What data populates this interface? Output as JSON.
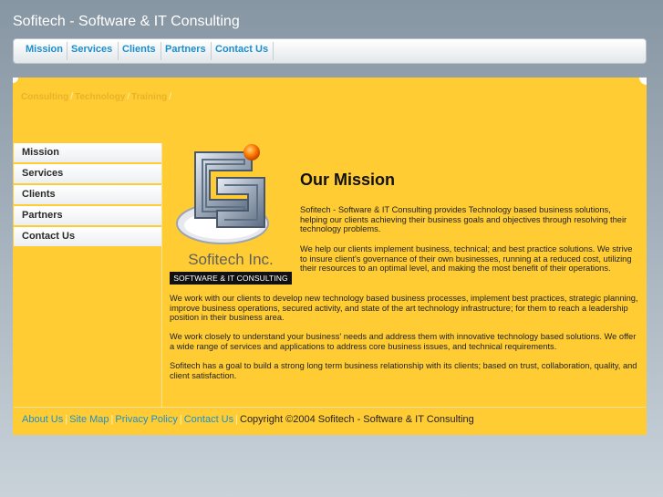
{
  "site": {
    "title": "Sofitech - Software & IT Consulting"
  },
  "topnav": {
    "items": [
      "Mission",
      "Services",
      "Clients",
      "Partners",
      "Contact Us"
    ]
  },
  "breadcrumb": {
    "items": [
      "Consulting",
      "Technology",
      "Training"
    ],
    "separator": "/"
  },
  "sidenav": {
    "items": [
      "Mission",
      "Services",
      "Clients",
      "Partners",
      "Contact Us"
    ]
  },
  "logo": {
    "name": "Sofitech Inc.",
    "tagline": "SOFTWARE & IT CONSULTING"
  },
  "main": {
    "heading": "Our Mission",
    "paragraphs": [
      "Sofitech - Software & IT Consulting provides Technology based business solutions, helping our clients achieving their business goals and objectives through resolving their technology problems.",
      "We help our clients implement business, technical; and best practice solutions. We strive to insure client's governance of their own businesses, running at a reduced cost, utilizing their resources to an optimal level, and making the most benefit of their operations.",
      "We work with our clients to develop new technology based business processes, implement best practices, strategic planning, improve business operations, secured activity, and state of the art technology infrastructure; for them to reach a leadership position in their business area.",
      "We work closely to understand your business' needs and address them with innovative technology based solutions. We offer a wide range of services and applications to address core business issues, and technical requirements.",
      "Sofitech has a goal to build a strong long term business relationship with its clients; based on trust, collaboration, quality, and client satisfaction."
    ]
  },
  "footer": {
    "links": [
      "About Us",
      "Site Map",
      "Privacy Policy",
      "Contact Us"
    ],
    "copyright": "Copyright ©2004 Sofitech - Software & IT Consulting"
  },
  "colors": {
    "panel": "#ffcc33",
    "link": "#1a8fd0",
    "breadcrumb": "#e8b22a"
  }
}
